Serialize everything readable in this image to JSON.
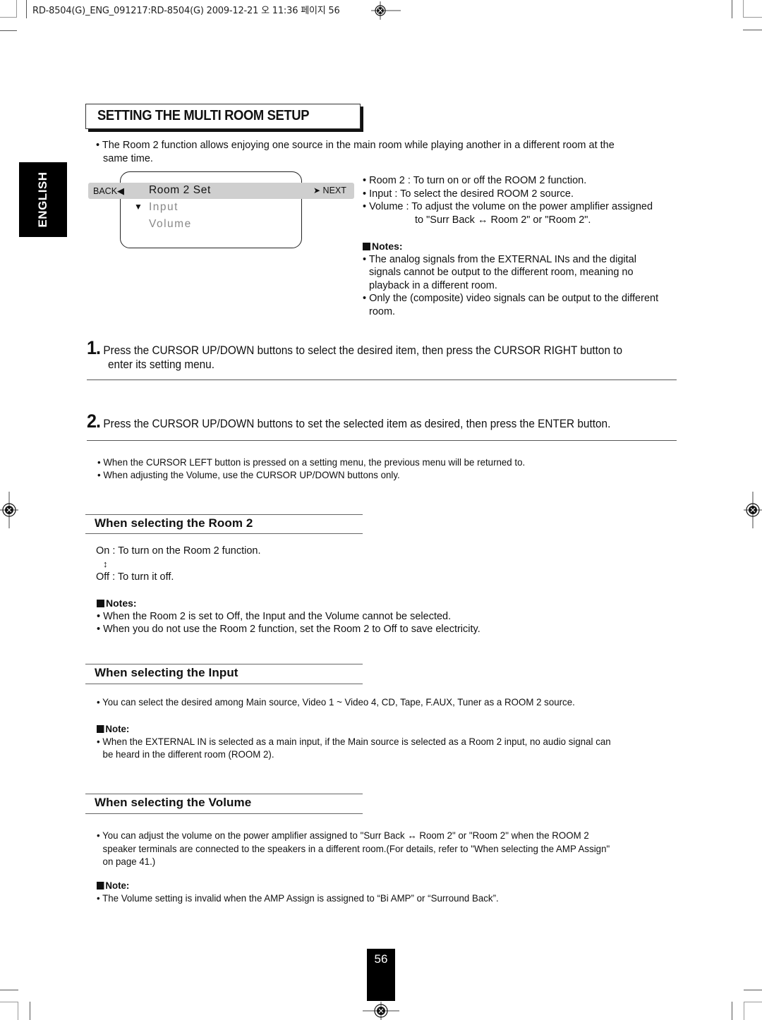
{
  "print_header": {
    "text": "RD-8504(G)_ENG_091217:RD-8504(G)  2009-12-21  오    11:36  페이지 56"
  },
  "side_tab": {
    "label": "ENGLISH"
  },
  "title": "SETTING THE MULTI ROOM SETUP",
  "intro": {
    "line1": "• The Room 2 function allows enjoying one source in the main room while playing another in a different room at the",
    "line2": "same time."
  },
  "osd_menu": {
    "back_label": "BACK",
    "back_icon": "triangle-left-icon",
    "title": "Room 2 Set",
    "next_label": "NEXT",
    "next_icon": "arrow-right-icon",
    "cursor_icon": "triangle-down-icon",
    "items": [
      "Input",
      "Volume"
    ]
  },
  "descriptions": [
    "• Room 2 : To turn on or off the ROOM 2 function.",
    "• Input : To select the desired ROOM 2 source.",
    "• Volume : To adjust the volume on the power amplifier assigned",
    "to \"Surr Back ↔ Room 2\" or \"Room 2\"."
  ],
  "top_notes": {
    "heading": "Notes:",
    "lines": [
      "• The analog signals from the EXTERNAL INs and the digital",
      "signals cannot be output to the different room, meaning no",
      "playback in a different room.",
      "• Only the (composite) video signals can be output to the different",
      "room."
    ]
  },
  "steps": [
    {
      "number": "1.",
      "line1": "Press the CURSOR UP/DOWN buttons to select the desired item, then press the CURSOR RIGHT button to",
      "line2": "enter its setting menu."
    },
    {
      "number": "2.",
      "line1": "Press the CURSOR UP/DOWN buttons to set the selected item as desired, then press the ENTER button."
    }
  ],
  "step_notes": [
    "• When the CURSOR LEFT button is pressed on a setting menu, the previous menu will be returned to.",
    "• When adjusting the Volume, use the CURSOR UP/DOWN buttons only."
  ],
  "sections": {
    "room2": {
      "heading": "When selecting the Room 2",
      "on_text": "On : To turn on the Room 2 function.",
      "toggle_icon": "↕",
      "off_text": "Off : To turn it off.",
      "notes_heading": "Notes:",
      "notes": [
        "• When the Room 2 is set to Off, the Input and the Volume cannot be selected.",
        "• When you do not use the Room 2 function, set the Room 2 to Off to save electricity."
      ]
    },
    "input": {
      "heading": "When selecting the Input",
      "body": "• You can select the desired among Main source, Video 1 ~ Video 4, CD, Tape, F.AUX, Tuner  as a ROOM 2 source.",
      "note_heading": "Note:",
      "note_line1": "• When the EXTERNAL IN is selected as a main input, if the Main source is selected as a Room 2 input, no audio signal can",
      "note_line2": "be heard in the different room (ROOM 2)."
    },
    "volume": {
      "heading": "When selecting the Volume",
      "body_line1": "• You can adjust the volume on the power amplifier assigned to \"Surr Back ↔ Room 2\" or \"Room 2\" when the ROOM 2",
      "body_line2": "speaker terminals are connected to the speakers in a different room.(For details, refer to \"When selecting the AMP Assign\"",
      "body_line3": "on page 41.)",
      "note_heading": "Note:",
      "note": "• The Volume setting is invalid when the AMP Assign is assigned to “Bi AMP” or “Surround Back”."
    }
  },
  "page_number": "56"
}
